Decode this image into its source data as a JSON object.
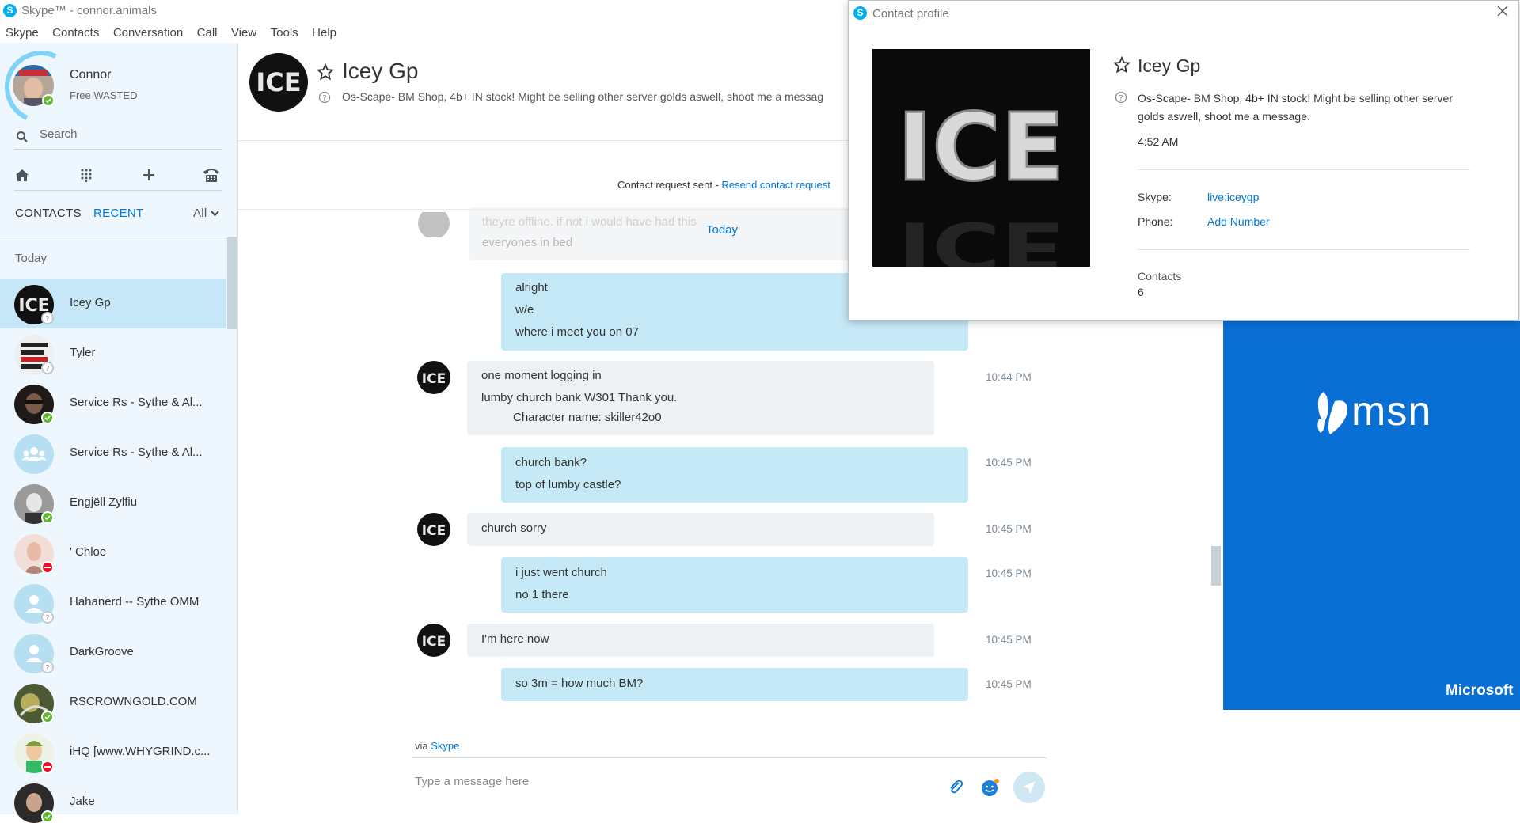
{
  "window": {
    "title": "Skype™ - connor.animals"
  },
  "menu": [
    "Skype",
    "Contacts",
    "Conversation",
    "Call",
    "View",
    "Tools",
    "Help"
  ],
  "me": {
    "name": "Connor",
    "mood": "Free WASTED",
    "status": "online"
  },
  "search": {
    "label": "Search"
  },
  "tabs": {
    "contacts": "CONTACTS",
    "recent": "RECENT",
    "filter": "All"
  },
  "recent_group": "Today",
  "contacts": [
    {
      "name": "Icey Gp",
      "status": "unknown",
      "selected": true
    },
    {
      "name": "Tyler",
      "status": "unknown"
    },
    {
      "name": "Service Rs - Sythe & Al...",
      "status": "online"
    },
    {
      "name": "Service Rs - Sythe & Al...",
      "status": "none",
      "group": true
    },
    {
      "name": "Engjëll Zylfiu",
      "status": "online"
    },
    {
      "name": "' Chloe",
      "status": "busy"
    },
    {
      "name": "Hahanerd -- Sythe OMM",
      "status": "unknown",
      "placeholder": true
    },
    {
      "name": "DarkGroove",
      "status": "unknown",
      "placeholder": true
    },
    {
      "name": "RSCROWNGOLD.COM",
      "status": "online"
    },
    {
      "name": "iHQ [www.WHYGRIND.c...",
      "status": "busy"
    },
    {
      "name": "Jake",
      "status": "online"
    }
  ],
  "conversation": {
    "name": "Icey Gp",
    "mood": "Os-Scape- BM Shop, 4b+ IN stock! Might be selling other server golds aswell, shoot me a messag",
    "request_text": "Contact request sent - ",
    "request_link": "Resend contact request",
    "day_label": "Today",
    "partial_lines": [
      "theyre offline. if not i would have had this",
      "everyones in bed"
    ],
    "messages": [
      {
        "dir": "out",
        "lines": [
          "alright",
          "w/e",
          "where i meet you on 07"
        ],
        "time": ""
      },
      {
        "dir": "in",
        "lines": [
          "one moment logging in",
          "lumby church bank W301 Thank you.",
          "Character name: skiller42o0"
        ],
        "time": "10:44 PM"
      },
      {
        "dir": "out",
        "lines": [
          "church bank?",
          "top of lumby castle?"
        ],
        "time": "10:45 PM"
      },
      {
        "dir": "in",
        "lines": [
          "church sorry"
        ],
        "time": "10:45 PM"
      },
      {
        "dir": "out",
        "lines": [
          "i just went church",
          "no 1 there"
        ],
        "time": "10:45 PM"
      },
      {
        "dir": "in",
        "lines": [
          "I'm here now"
        ],
        "time": "10:45 PM"
      },
      {
        "dir": "out",
        "lines": [
          "so 3m = how much BM?"
        ],
        "time": "10:45 PM"
      }
    ],
    "via_prefix": "via ",
    "via_link": "Skype",
    "compose_placeholder": "Type a message here"
  },
  "ad": {
    "brand": "msn",
    "footer": "Microsoft",
    "color": "#0a6fd4"
  },
  "profile": {
    "window_title": "Contact profile",
    "name": "Icey Gp",
    "mood": "Os-Scape- BM Shop, 4b+ IN stock! Might be selling other server golds aswell, shoot me a message.",
    "local_time": "4:52 AM",
    "skype_label": "Skype:",
    "skype_value": "live:iceygp",
    "phone_label": "Phone:",
    "phone_value": "Add Number",
    "contacts_label": "Contacts",
    "contacts_value": "6",
    "image_text": "ICE"
  },
  "icons": [
    "skype-logo-icon",
    "search-icon",
    "home-icon",
    "dialpad-icon",
    "add-icon",
    "phone-icon",
    "chevron-down-icon",
    "star-icon",
    "help-circle-icon",
    "attach-icon",
    "emoticon-icon",
    "send-icon",
    "close-icon",
    "msn-butterfly-icon"
  ],
  "colors": {
    "accent": "#0078d7",
    "skype": "#00aff0",
    "online": "#5fb732",
    "busy": "#e81123",
    "sidebar": "#edf7fd",
    "selected": "#c6e7f7",
    "bubble_out": "#c6e9f8",
    "bubble_in": "#eef1f4"
  }
}
